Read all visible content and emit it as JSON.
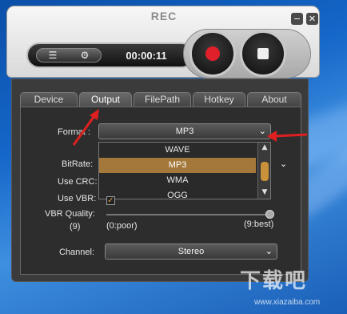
{
  "app": {
    "title": "REC",
    "timer": "00:00:11"
  },
  "window_controls": {
    "minimize": "−",
    "close": "✕"
  },
  "icons": {
    "list": "list-icon",
    "gear": "gear-icon",
    "record": "record-icon",
    "stop": "stop-icon"
  },
  "tabs": [
    {
      "label": "Device",
      "active": false
    },
    {
      "label": "Output",
      "active": true
    },
    {
      "label": "FilePath",
      "active": false
    },
    {
      "label": "Hotkey",
      "active": false
    },
    {
      "label": "About",
      "active": false
    }
  ],
  "output": {
    "format_label": "Format :",
    "format_value": "MP3",
    "format_options": [
      "WAVE",
      "MP3",
      "WMA",
      "OGG"
    ],
    "format_selected_index": 1,
    "bitrate_label": "BitRate:",
    "use_crc_label": "Use CRC:",
    "use_vbr_label": "Use VBR:",
    "use_vbr_checked": true,
    "vbr_quality_label": "VBR Quality:",
    "vbr_quality_value": "(9)",
    "vbr_min_label": "(0:poor)",
    "vbr_max_label": "(9:best)",
    "vbr_level": 9,
    "channel_label": "Channel:",
    "channel_value": "Stereo"
  },
  "watermark": {
    "text": "下载吧",
    "url": "www.xiazaiba.com"
  },
  "colors": {
    "accent": "#a3783a",
    "record": "#e0202a",
    "annotation": "#e02020"
  }
}
